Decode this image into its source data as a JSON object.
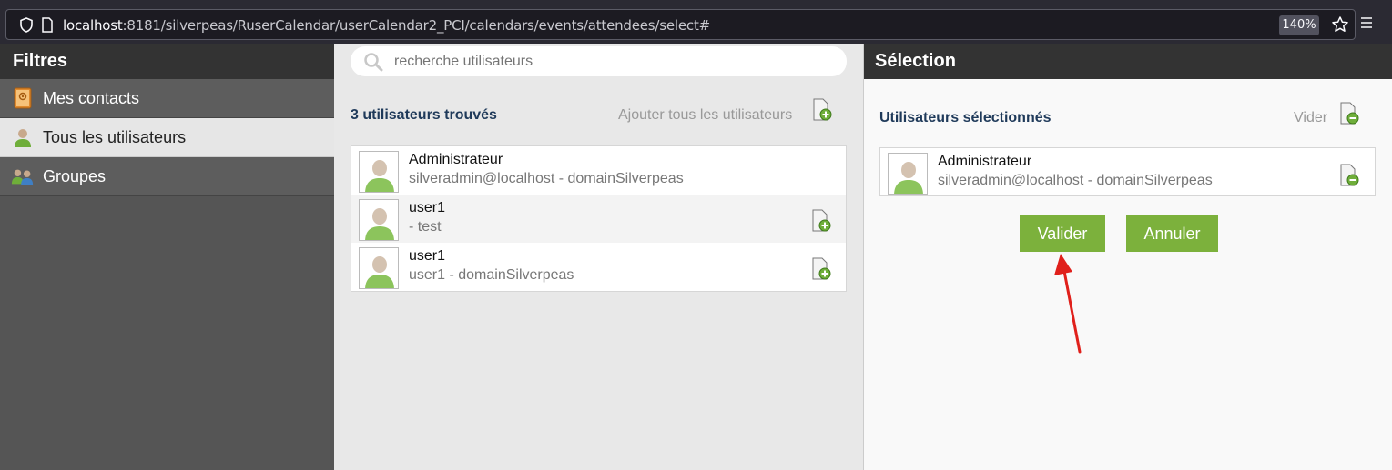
{
  "browser": {
    "url_host": "localhost",
    "url_rest": ":8181/silverpeas/RuserCalendar/userCalendar2_PCI/calendars/events/attendees/select#",
    "zoom": "140%"
  },
  "filters": {
    "title": "Filtres",
    "items": [
      {
        "label": "Mes contacts",
        "icon": "contacts-book-icon"
      },
      {
        "label": "Tous les utilisateurs",
        "icon": "user-icon"
      },
      {
        "label": "Groupes",
        "icon": "group-icon"
      }
    ]
  },
  "search": {
    "placeholder": "recherche utilisateurs",
    "found_label": "3 utilisateurs trouvés",
    "add_all_label": "Ajouter tous les utilisateurs",
    "results": [
      {
        "name": "Administrateur",
        "detail": "silveradmin@localhost - domainSilverpeas"
      },
      {
        "name": "user1",
        "detail": "- test"
      },
      {
        "name": "user1",
        "detail": "user1 - domainSilverpeas"
      }
    ]
  },
  "selection": {
    "title": "Sélection",
    "selected_label": "Utilisateurs sélectionnés",
    "clear_label": "Vider",
    "items": [
      {
        "name": "Administrateur",
        "detail": "silveradmin@localhost - domainSilverpeas"
      }
    ],
    "validate_label": "Valider",
    "cancel_label": "Annuler"
  },
  "colors": {
    "accent_green": "#7cb13c",
    "header_dark": "#333333",
    "title_blue": "#1f3a5a",
    "annotation_arrow": "#e0201b"
  }
}
